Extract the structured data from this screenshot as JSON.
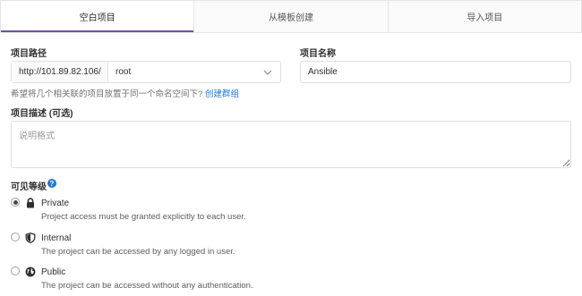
{
  "tabs": [
    {
      "label": "空白项目",
      "active": true
    },
    {
      "label": "从模板创建",
      "active": false
    },
    {
      "label": "导入项目",
      "active": false
    }
  ],
  "form": {
    "path_label": "项目路径",
    "path_prefix": "http://101.89.82.106/",
    "namespace_value": "root",
    "name_label": "项目名称",
    "name_value": "Ansible",
    "group_help_text": "希望将几个相关联的项目放置于同一个命名空间下?",
    "group_help_link": "创建群组",
    "description_label": "项目描述 (可选)",
    "description_placeholder": "说明格式",
    "visibility_label": "可见等级",
    "visibility_help_glyph": "?"
  },
  "visibility_options": [
    {
      "title": "Private",
      "description": "Project access must be granted explicitly to each user.",
      "icon": "lock-icon",
      "selected": true
    },
    {
      "title": "Internal",
      "description": "The project can be accessed by any logged in user.",
      "icon": "shield-icon",
      "selected": false
    },
    {
      "title": "Public",
      "description": "The project can be accessed without any authentication.",
      "icon": "globe-icon",
      "selected": false
    }
  ],
  "colors": {
    "active_tab_underline": "#6b4fbb",
    "link": "#1f78d1",
    "border": "#dfdfdf"
  }
}
